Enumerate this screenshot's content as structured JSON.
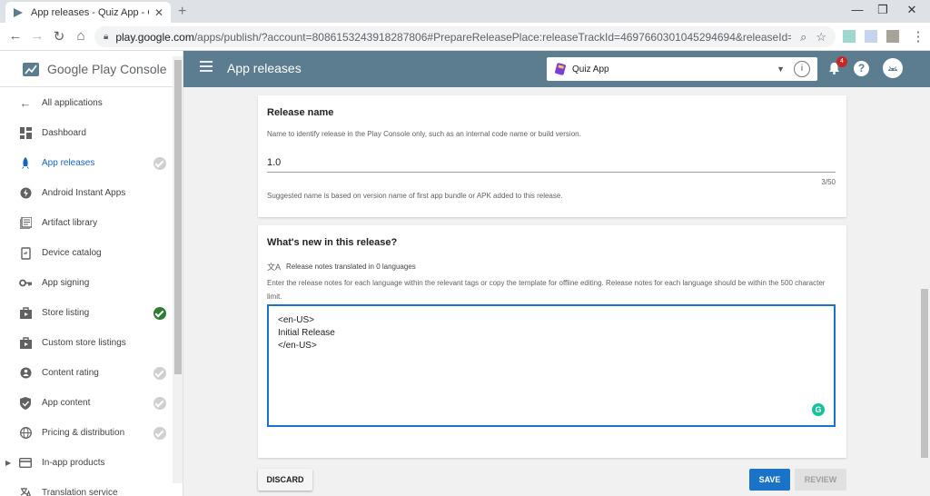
{
  "browser": {
    "tab_title": "App releases - Quiz App - Googl…",
    "url_host": "play.google.com",
    "url_rest": "/apps/publish/?account=8086153243918287806#PrepareReleasePlace:releaseTrackId=4697660301045294694&releaseId=470264105641412..."
  },
  "sidebar": {
    "brand": "Google Play Console",
    "items": [
      {
        "label": "All applications",
        "icon": "arrow-back-icon"
      },
      {
        "label": "Dashboard",
        "icon": "dashboard-icon"
      },
      {
        "label": "App releases",
        "icon": "rocket-icon",
        "active": true,
        "status": "todo"
      },
      {
        "label": "Android Instant Apps",
        "icon": "instant-apps-icon"
      },
      {
        "label": "Artifact library",
        "icon": "library-icon"
      },
      {
        "label": "Device catalog",
        "icon": "device-icon"
      },
      {
        "label": "App signing",
        "icon": "key-icon"
      },
      {
        "label": "Store listing",
        "icon": "store-icon",
        "status": "ok"
      },
      {
        "label": "Custom store listings",
        "icon": "store-icon"
      },
      {
        "label": "Content rating",
        "icon": "rating-icon",
        "status": "todo"
      },
      {
        "label": "App content",
        "icon": "shield-icon",
        "status": "todo"
      },
      {
        "label": "Pricing & distribution",
        "icon": "globe-icon",
        "status": "todo"
      },
      {
        "label": "In-app products",
        "icon": "card-icon",
        "expandable": true
      },
      {
        "label": "Translation service",
        "icon": "translate-icon"
      }
    ]
  },
  "header": {
    "title": "App releases",
    "app_name": "Quiz App",
    "notification_count": "4"
  },
  "release_name": {
    "title": "Release name",
    "help": "Name to identify release in the Play Console only, such as an internal code name or build version.",
    "value": "1.0",
    "counter": "3/50",
    "note": "Suggested name is based on version name of first app bundle or APK added to this release."
  },
  "whats_new": {
    "title": "What's new in this release?",
    "translated": "Release notes translated in 0 languages",
    "help": "Enter the release notes for each language within the relevant tags or copy the template for offline editing. Release notes for each language should be within the 500 character limit.",
    "notes": [
      "<en-US>",
      "Initial Release",
      "</en-US>"
    ]
  },
  "actions": {
    "discard": "DISCARD",
    "save": "SAVE",
    "review": "REVIEW"
  },
  "colors": {
    "header_bg": "#5c7d8f",
    "primary": "#1a73c8",
    "success": "#2e7d32"
  }
}
